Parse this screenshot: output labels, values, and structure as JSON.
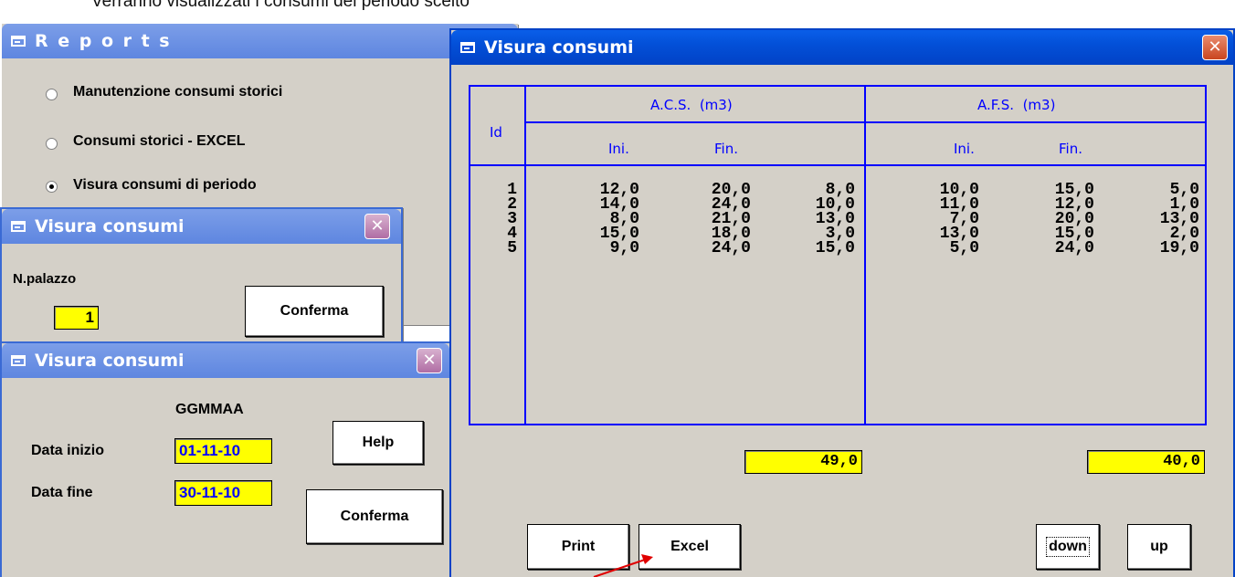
{
  "caption": "Verranno visualizzati i consumi del periodo scelto",
  "reports_window": {
    "title": "R e p o r t s",
    "options": [
      {
        "label": "Manutenzione consumi storici",
        "selected": false
      },
      {
        "label": "Consumi storici - EXCEL",
        "selected": false
      },
      {
        "label": "Visura consumi di periodo",
        "selected": true
      }
    ]
  },
  "palazzo_window": {
    "title": "Visura consumi",
    "field_label": "N.palazzo",
    "field_value": "1",
    "confirm_label": "Conferma"
  },
  "date_window": {
    "title": "Visura consumi",
    "format_label": "GGMMAA",
    "start_label": "Data inizio",
    "start_value": "01-11-10",
    "end_label": "Data fine",
    "end_value": "30-11-10",
    "help_label": "Help",
    "confirm_label": "Conferma"
  },
  "main_window": {
    "title": "Visura consumi",
    "table": {
      "id_header": "Id",
      "acs_header": "A.C.S.  (m3)",
      "afs_header": "A.F.S.  (m3)",
      "ini_header": "Ini.",
      "fin_header": "Fin.",
      "rows": [
        {
          "id": "1",
          "acs_ini": "12,0",
          "acs_fin": "20,0",
          "acs_diff": "8,0",
          "afs_ini": "10,0",
          "afs_fin": "15,0",
          "afs_diff": "5,0"
        },
        {
          "id": "2",
          "acs_ini": "14,0",
          "acs_fin": "24,0",
          "acs_diff": "10,0",
          "afs_ini": "11,0",
          "afs_fin": "12,0",
          "afs_diff": "1,0"
        },
        {
          "id": "3",
          "acs_ini": "8,0",
          "acs_fin": "21,0",
          "acs_diff": "13,0",
          "afs_ini": "7,0",
          "afs_fin": "20,0",
          "afs_diff": "13,0"
        },
        {
          "id": "4",
          "acs_ini": "15,0",
          "acs_fin": "18,0",
          "acs_diff": "3,0",
          "afs_ini": "13,0",
          "afs_fin": "15,0",
          "afs_diff": "2,0"
        },
        {
          "id": "5",
          "acs_ini": "9,0",
          "acs_fin": "24,0",
          "acs_diff": "15,0",
          "afs_ini": "5,0",
          "afs_fin": "24,0",
          "afs_diff": "19,0"
        }
      ]
    },
    "acs_total": "49,0",
    "afs_total": "40,0",
    "print_label": "Print",
    "excel_label": "Excel",
    "down_label": "down",
    "up_label": "up"
  },
  "colors": {
    "titlebar": "#0350d8",
    "grid": "#0000ff",
    "field": "#ffff00",
    "field_text_blue": "#0000ff"
  }
}
